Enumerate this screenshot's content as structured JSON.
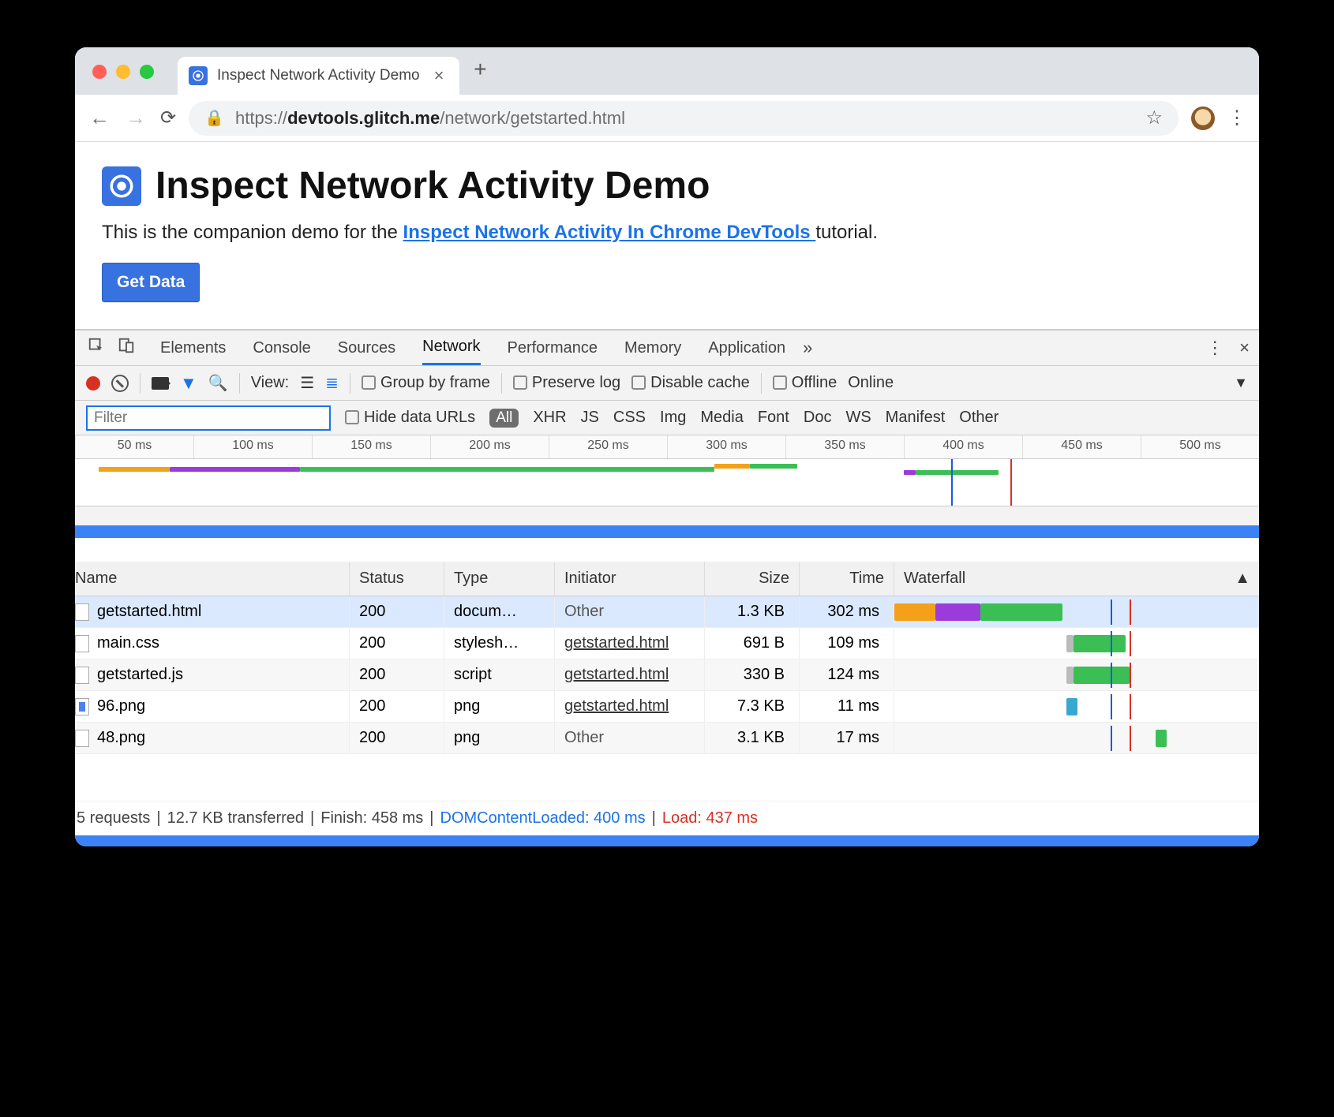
{
  "browser": {
    "tab_title": "Inspect Network Activity Demo",
    "url_host": "devtools.glitch.me",
    "url_prefix": "https://",
    "url_path": "/network/getstarted.html"
  },
  "page": {
    "heading": "Inspect Network Activity Demo",
    "intro_before": "This is the companion demo for the ",
    "intro_link": "Inspect Network Activity In Chrome DevTools ",
    "intro_after": "tutorial.",
    "button": "Get Data"
  },
  "devtools": {
    "tabs": [
      "Elements",
      "Console",
      "Sources",
      "Network",
      "Performance",
      "Memory",
      "Application"
    ],
    "active_tab": "Network",
    "view_label": "View:",
    "group_by_frame": "Group by frame",
    "preserve_log": "Preserve log",
    "disable_cache": "Disable cache",
    "offline": "Offline",
    "online": "Online",
    "filter_placeholder": "Filter",
    "hide_urls": "Hide data URLs",
    "types": [
      "All",
      "XHR",
      "JS",
      "CSS",
      "Img",
      "Media",
      "Font",
      "Doc",
      "WS",
      "Manifest",
      "Other"
    ],
    "ruler": [
      "50 ms",
      "100 ms",
      "150 ms",
      "200 ms",
      "250 ms",
      "300 ms",
      "350 ms",
      "400 ms",
      "450 ms",
      "500 ms"
    ],
    "columns": [
      "Name",
      "Status",
      "Type",
      "Initiator",
      "Size",
      "Time",
      "Waterfall"
    ],
    "rows": [
      {
        "name": "getstarted.html",
        "status": "200",
        "type": "docum…",
        "initiator": "Other",
        "initiator_link": false,
        "size": "1.3 KB",
        "time": "302 ms",
        "selected": true,
        "bars": [
          {
            "l": 0,
            "w": 11,
            "c": "#f4a11a"
          },
          {
            "l": 11,
            "w": 12,
            "c": "#9b3bdc"
          },
          {
            "l": 23,
            "w": 22,
            "c": "#3bbf55"
          }
        ]
      },
      {
        "name": "main.css",
        "status": "200",
        "type": "stylesh…",
        "initiator": "getstarted.html",
        "initiator_link": true,
        "size": "691 B",
        "time": "109 ms",
        "bars": [
          {
            "l": 46,
            "w": 2,
            "c": "#bbb"
          },
          {
            "l": 48,
            "w": 14,
            "c": "#3bbf55"
          }
        ]
      },
      {
        "name": "getstarted.js",
        "status": "200",
        "type": "script",
        "initiator": "getstarted.html",
        "initiator_link": true,
        "size": "330 B",
        "time": "124 ms",
        "bars": [
          {
            "l": 46,
            "w": 2,
            "c": "#bbb"
          },
          {
            "l": 48,
            "w": 15,
            "c": "#3bbf55"
          }
        ]
      },
      {
        "name": "96.png",
        "status": "200",
        "type": "png",
        "initiator": "getstarted.html",
        "initiator_link": true,
        "size": "7.3 KB",
        "time": "11 ms",
        "icon": "blue",
        "bars": [
          {
            "l": 46,
            "w": 3,
            "c": "#37a9d1"
          }
        ]
      },
      {
        "name": "48.png",
        "status": "200",
        "type": "png",
        "initiator": "Other",
        "initiator_link": false,
        "size": "3.1 KB",
        "time": "17 ms",
        "bars": [
          {
            "l": 70,
            "w": 3,
            "c": "#3bbf55"
          }
        ]
      }
    ],
    "vlines": [
      {
        "l": 58,
        "c": "#1a5adf"
      },
      {
        "l": 63,
        "c": "#d93025"
      }
    ],
    "overview_bars": [
      {
        "l": 2,
        "w": 6,
        "c": "#f4a11a",
        "t": 10
      },
      {
        "l": 8,
        "w": 11,
        "c": "#9b3bdc",
        "t": 10
      },
      {
        "l": 19,
        "w": 35,
        "c": "#3bbf55",
        "t": 10
      },
      {
        "l": 54,
        "w": 3,
        "c": "#f4a11a",
        "t": 6
      },
      {
        "l": 57,
        "w": 4,
        "c": "#3bbf55",
        "t": 6
      },
      {
        "l": 70,
        "w": 1,
        "c": "#9b3bdc",
        "t": 14
      },
      {
        "l": 71,
        "w": 7,
        "c": "#3bbf55",
        "t": 14
      }
    ],
    "overview_lines": [
      {
        "l": 74,
        "c": "#1a5adf"
      },
      {
        "l": 79,
        "c": "#d93025"
      }
    ],
    "status": {
      "requests": "5 requests",
      "transferred": "12.7 KB transferred",
      "finish": "Finish: 458 ms",
      "dom": "DOMContentLoaded: 400 ms",
      "load": "Load: 437 ms"
    }
  }
}
